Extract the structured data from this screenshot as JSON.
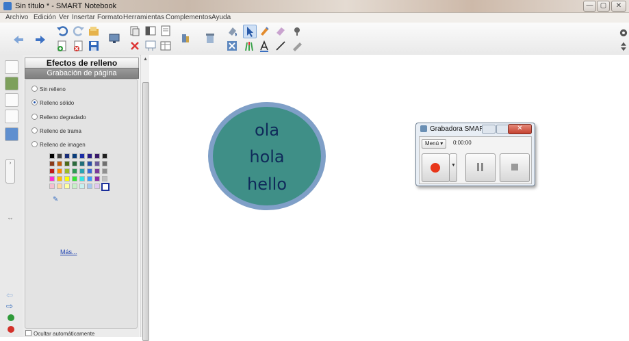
{
  "window": {
    "title": "Sin título * - SMART Notebook",
    "min_glyph": "—",
    "max_glyph": "▢",
    "close_glyph": "✕"
  },
  "menu": [
    "Archivo",
    "Edición",
    "Ver",
    "Insertar",
    "Formato",
    "Herramientas",
    "Complementos",
    "Ayuda"
  ],
  "toolbar": {
    "icons": [
      "back-icon",
      "forward-icon",
      "undo-icon",
      "redo-icon",
      "open-icon",
      "save-icon",
      "new-page-icon",
      "delete-page-icon",
      "screen-icon",
      "paste-icon",
      "delete-icon",
      "screen-shade-icon",
      "table-icon",
      "capture-icon",
      "document-camera-icon",
      "properties-icon",
      "select-icon",
      "pen-icon",
      "eraser-icon",
      "shapes-icon",
      "text-icon",
      "line-icon",
      "fill-icon",
      "settings-icon",
      "move-toolbar-icon"
    ]
  },
  "panel": {
    "title": "Efectos de relleno",
    "subtitle": "Grabación de página",
    "options": [
      {
        "label": "Sin relleno",
        "selected": false
      },
      {
        "label": "Relleno sólido",
        "selected": true
      },
      {
        "label": "Relleno degradado",
        "selected": false
      },
      {
        "label": "Relleno de trama",
        "selected": false
      },
      {
        "label": "Relleno de imagen",
        "selected": false
      }
    ],
    "palette": [
      [
        "#000000",
        "#404040",
        "#1a2e7a",
        "#0a3d7a",
        "#1b2da6",
        "#2a1c85",
        "#3a1a6a",
        "#202020"
      ],
      [
        "#8a3a1a",
        "#c45b0a",
        "#4d6a1a",
        "#2c6a3c",
        "#216d7a",
        "#2a4ea8",
        "#6a5a9a",
        "#707070"
      ],
      [
        "#c01818",
        "#ff8c00",
        "#9bbb28",
        "#2f9a55",
        "#2aa3b3",
        "#3a6ad8",
        "#7a3a9a",
        "#909090"
      ],
      [
        "#ff2bd0",
        "#ffc000",
        "#ffff00",
        "#32e632",
        "#33e6e6",
        "#3a9aff",
        "#8a2aa8",
        "#c0c0c0"
      ],
      [
        "#f5c0d0",
        "#ffd9a0",
        "#ffffa0",
        "#c8f0c8",
        "#c8f0f0",
        "#a8c8f0",
        "#e0c8f0",
        "#ffffff"
      ]
    ],
    "more_label": "Más...",
    "autohide_label": "Ocultar automáticamente"
  },
  "canvas": {
    "circle_lines": [
      "ola",
      "hola",
      "hello"
    ],
    "circle_fill": "#3f8f87",
    "circle_border": "#7f9fc7"
  },
  "recorder": {
    "title": "Grabadora SMART",
    "menu_label": "Menú",
    "time": "0:00:00",
    "record_color": "#e8361a"
  }
}
